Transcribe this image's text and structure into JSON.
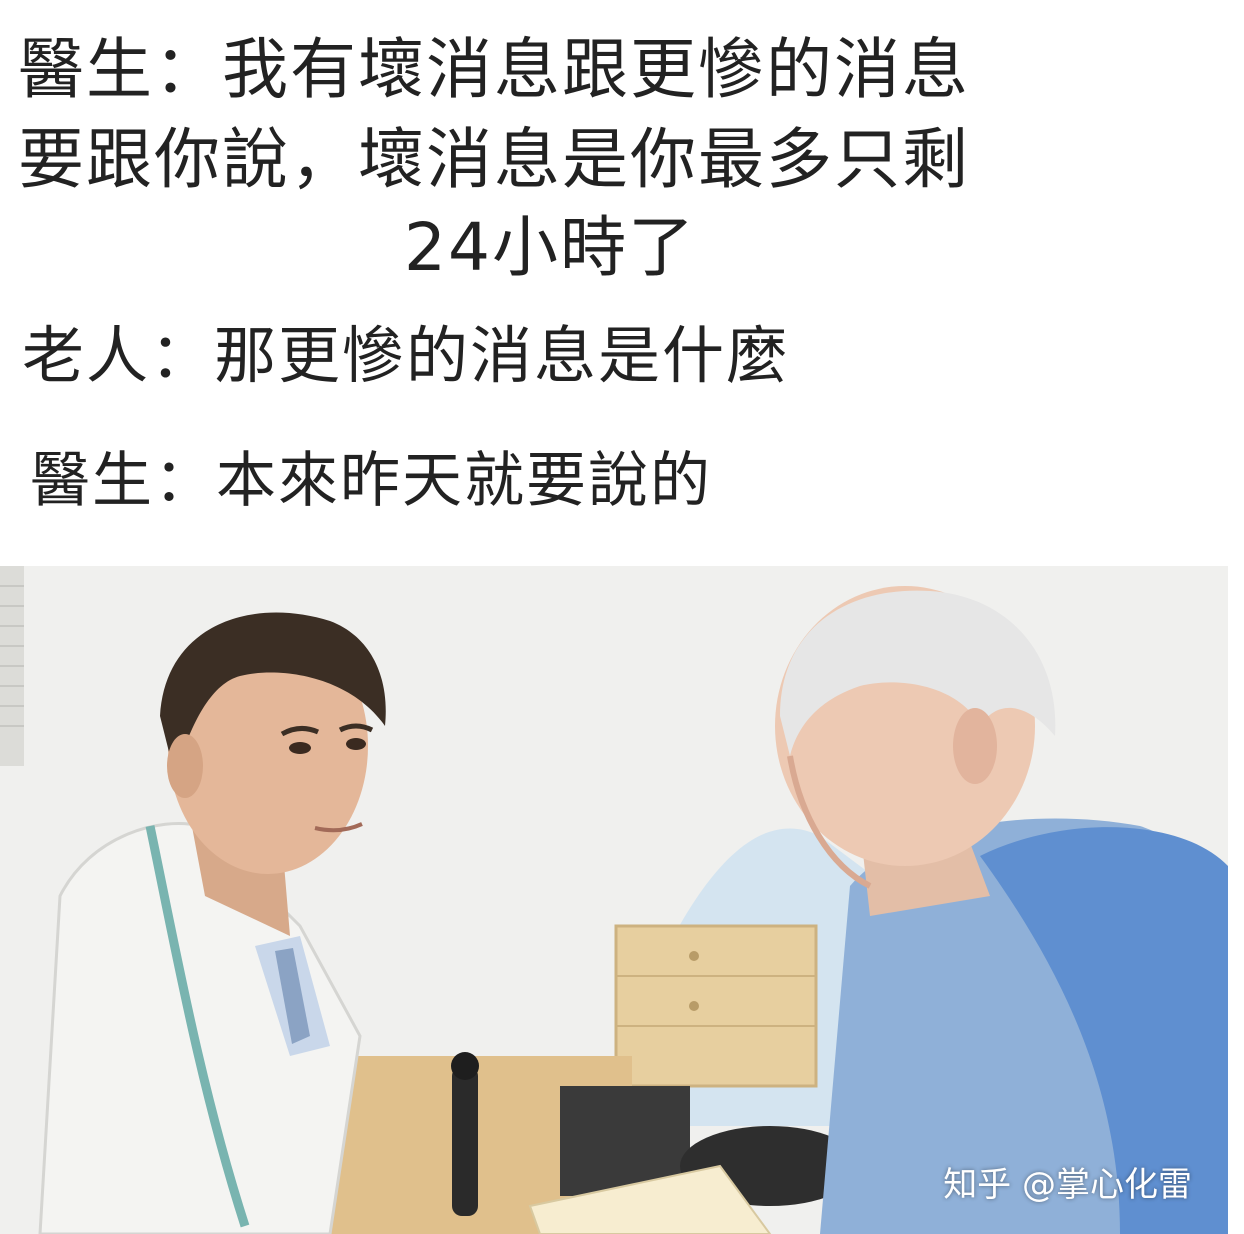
{
  "caption": {
    "line1": "醫生：我有壞消息跟更慘的消息",
    "line2": "要跟你說，壞消息是你最多只剩",
    "line3": "24小時了",
    "line4": "老人：那更慘的消息是什麼",
    "line5": "醫生：本來昨天就要說的"
  },
  "watermark": "知乎 @掌心化雷",
  "colors": {
    "background": "#ffffff",
    "text": "#222222",
    "coat": "#f4f4f2",
    "shirt": "#8fb0d8",
    "vest": "#5f8fd0",
    "hair_gray": "#e6e6e6",
    "cabinet": "#e7cf9f"
  }
}
